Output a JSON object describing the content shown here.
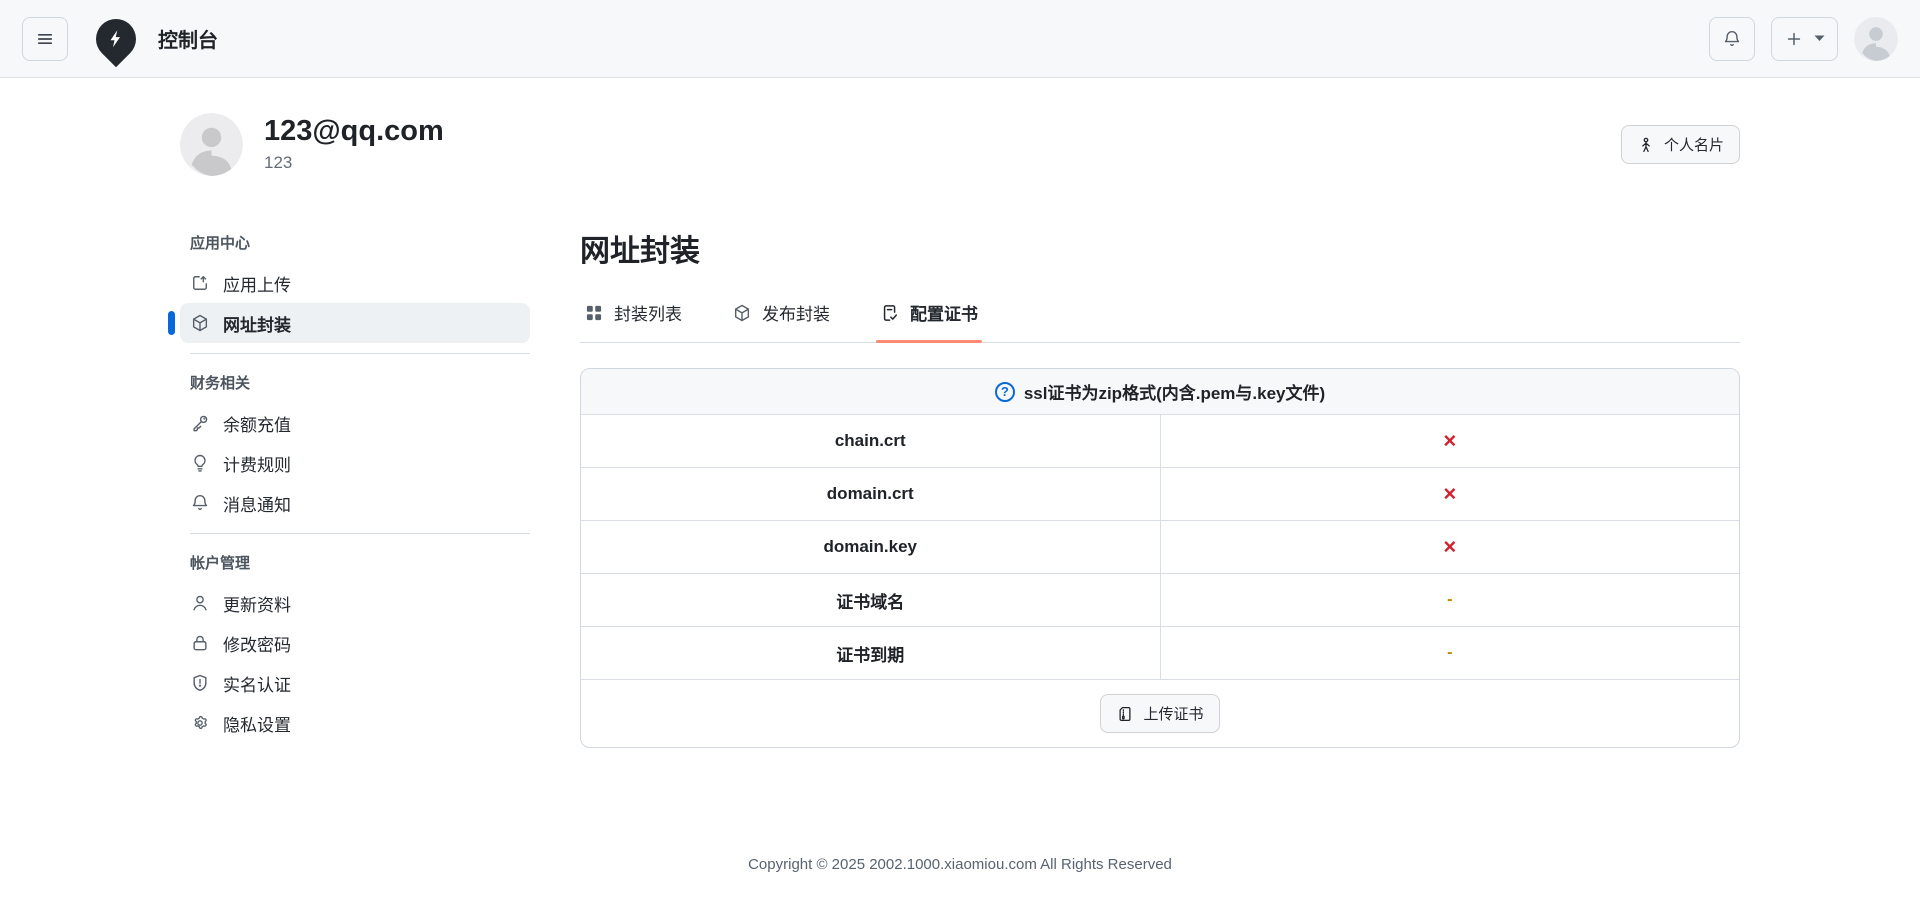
{
  "header": {
    "title": "控制台",
    "icons": [
      "menu-icon",
      "logo-bolt-pin",
      "bell-icon",
      "plus-icon",
      "caret-down-icon",
      "user-avatar"
    ]
  },
  "profile": {
    "email": "123@qq.com",
    "username": "123",
    "card_button": "个人名片"
  },
  "sidebar": {
    "sections": [
      {
        "title": "应用中心",
        "items": [
          {
            "label": "应用上传",
            "icon": "upload-icon",
            "active": false
          },
          {
            "label": "网址封装",
            "icon": "package-icon",
            "active": true
          }
        ]
      },
      {
        "title": "财务相关",
        "items": [
          {
            "label": "余额充值",
            "icon": "key-icon",
            "active": false
          },
          {
            "label": "计费规则",
            "icon": "lightbulb-icon",
            "active": false
          },
          {
            "label": "消息通知",
            "icon": "bell-icon",
            "active": false
          }
        ]
      },
      {
        "title": "帐户管理",
        "items": [
          {
            "label": "更新资料",
            "icon": "person-icon",
            "active": false
          },
          {
            "label": "修改密码",
            "icon": "lock-icon",
            "active": false
          },
          {
            "label": "实名认证",
            "icon": "shield-icon",
            "active": false
          },
          {
            "label": "隐私设置",
            "icon": "gear-icon",
            "active": false
          }
        ]
      }
    ]
  },
  "main": {
    "title": "网址封装",
    "tabs": [
      {
        "label": "封装列表",
        "icon": "apps-grid-icon",
        "active": false
      },
      {
        "label": "发布封装",
        "icon": "package-icon",
        "active": false
      },
      {
        "label": "配置证书",
        "icon": "file-check-icon",
        "active": true
      }
    ],
    "certificate_table": {
      "notice": "ssl证书为zip格式(内含.pem与.key文件)",
      "rows": [
        {
          "name": "chain.crt",
          "status": "×",
          "status_type": "missing"
        },
        {
          "name": "domain.crt",
          "status": "×",
          "status_type": "missing"
        },
        {
          "name": "domain.key",
          "status": "×",
          "status_type": "missing"
        },
        {
          "name": "证书域名",
          "status": "-",
          "status_type": "empty"
        },
        {
          "name": "证书到期",
          "status": "-",
          "status_type": "empty"
        }
      ],
      "upload_button": "上传证书"
    }
  },
  "footer": {
    "copyright": "Copyright © 2025 2002.1000.xiaomiou.com All Rights Reserved"
  },
  "colors": {
    "accent_blue": "#0969da",
    "danger_red": "#cf222e",
    "attention_yellow": "#bf8700",
    "tab_underline": "#fd8c73",
    "header_bg": "#f6f8fa"
  }
}
